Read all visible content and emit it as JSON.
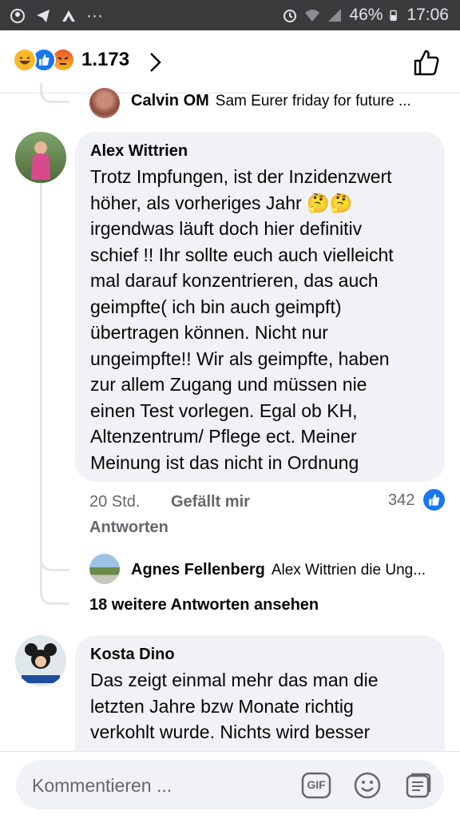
{
  "status_bar": {
    "battery": "46%",
    "time": "17:06",
    "icons_left": [
      "messenger-icon",
      "telegram-icon",
      "vpn-icon",
      "more-icon"
    ],
    "icons_right": [
      "alarm-icon",
      "wifi-icon",
      "signal-icon",
      "battery-icon"
    ]
  },
  "reactions": {
    "count": "1.173",
    "types": [
      "haha",
      "like",
      "angry"
    ]
  },
  "replies_top": {
    "author": "Calvin OM",
    "snippet": "Sam Eurer friday for future ..."
  },
  "comment1": {
    "author": "Alex Wittrien",
    "text": "Trotz Impfungen, ist der Inzidenzwert\nhöher, als vorheriges Jahr 🤔🤔\nirgendwas läuft doch hier definitiv\nschief !! Ihr sollte euch auch vielleicht\nmal darauf konzentrieren, das auch\ngeimpfte( ich bin auch geimpft)\nübertragen können. Nicht nur\nungeimpfte!! Wir als geimpfte, haben\nzur allem Zugang und müssen nie\neinen Test vorlegen. Egal ob KH,\nAltenzentrum/ Pflege ect. Meiner\nMeinung ist das nicht in Ordnung",
    "time": "20 Std.",
    "like_label": "Gefällt mir",
    "reply_label": "Antworten",
    "like_count": "342"
  },
  "reply1": {
    "author": "Agnes Fellenberg",
    "snippet": "Alex Wittrien die Ung..."
  },
  "more_replies": "18 weitere Antworten ansehen",
  "comment2": {
    "author": "Kosta Dino",
    "text": "Das zeigt einmal mehr das man die\nletzten Jahre bzw Monate richtig\nverkohlt wurde. Nichts wird besser"
  },
  "composer": {
    "placeholder": "Kommentieren ...",
    "gif_label": "GIF"
  },
  "colors": {
    "like_blue": "#1877f2",
    "bubble_bg": "#f0f2f5",
    "meta_gray": "#65676b",
    "statusbar_bg": "#3a3b3c"
  }
}
